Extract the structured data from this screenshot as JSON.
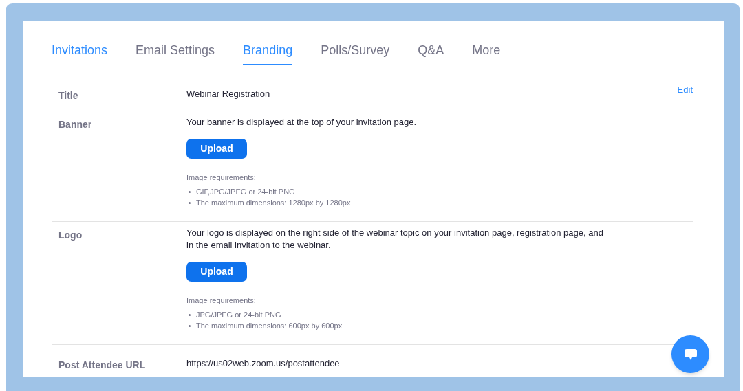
{
  "tabs": [
    {
      "label": "Invitations",
      "selected": false,
      "color": "#2d8cff"
    },
    {
      "label": "Email Settings",
      "selected": false,
      "color": "#747487"
    },
    {
      "label": "Branding",
      "selected": true,
      "color": "#2d8cff"
    },
    {
      "label": "Polls/Survey",
      "selected": false,
      "color": "#747487"
    },
    {
      "label": "Q&A",
      "selected": false,
      "color": "#747487"
    },
    {
      "label": "More",
      "selected": false,
      "color": "#747487"
    }
  ],
  "rows": [
    {
      "kind": "text",
      "label": "Title",
      "value": "Webinar Registration",
      "action": "Edit"
    },
    {
      "kind": "upload",
      "label": "Banner",
      "description": "Your banner is displayed at the top of your invitation page.",
      "button": "Upload",
      "requirements_title": "Image requirements:",
      "requirements": [
        "GIF,JPG/JPEG or 24-bit PNG",
        "The maximum dimensions: 1280px by 1280px"
      ]
    },
    {
      "kind": "upload",
      "label": "Logo",
      "description": "Your logo is displayed on the right side of the webinar topic on your invitation page, registration page, and in the email invitation to the webinar.",
      "button": "Upload",
      "requirements_title": "Image requirements:",
      "requirements": [
        "JPG/JPEG or 24-bit PNG",
        "The maximum dimensions: 600px by 600px"
      ]
    },
    {
      "kind": "text",
      "label": "Post Attendee URL",
      "value": "https://us02web.zoom.us/postattendee"
    }
  ]
}
